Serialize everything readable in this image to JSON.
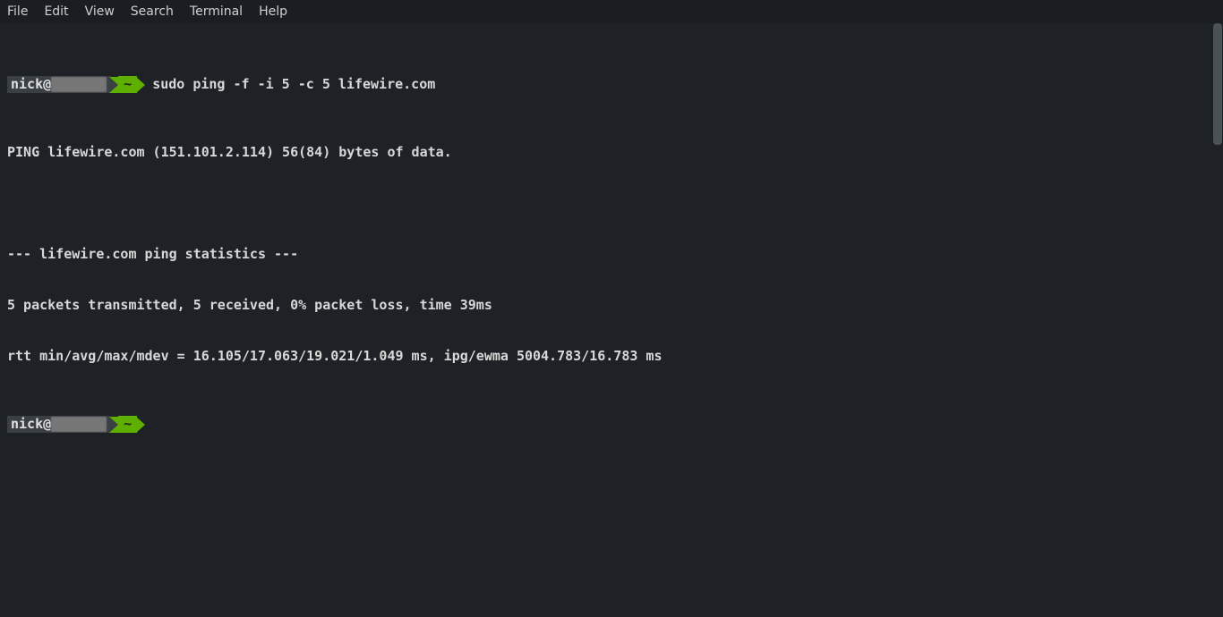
{
  "menubar": {
    "items": [
      "File",
      "Edit",
      "View",
      "Search",
      "Terminal",
      "Help"
    ]
  },
  "prompt1": {
    "user": "nick@",
    "path": "~",
    "command": "sudo ping -f -i 5 -c 5 lifewire.com"
  },
  "output": {
    "line1": "PING lifewire.com (151.101.2.114) 56(84) bytes of data.",
    "blank1": "",
    "line2": "--- lifewire.com ping statistics ---",
    "line3": "5 packets transmitted, 5 received, 0% packet loss, time 39ms",
    "line4": "rtt min/avg/max/mdev = 16.105/17.063/19.021/1.049 ms, ipg/ewma 5004.783/16.783 ms"
  },
  "prompt2": {
    "user": "nick@",
    "path": "~"
  }
}
